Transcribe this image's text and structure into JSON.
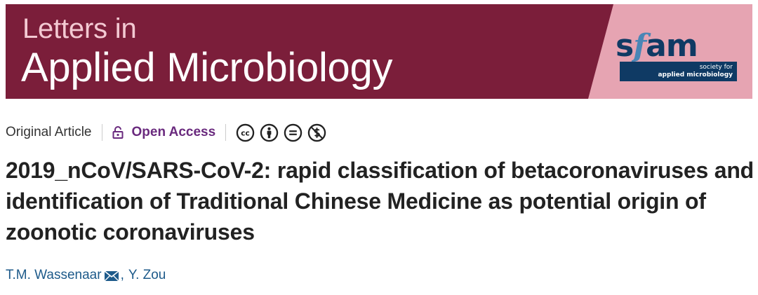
{
  "banner": {
    "journal_line1": "Letters in",
    "journal_line2": "Applied Microbiology",
    "colors": {
      "maroon": "#7b1e3a",
      "pink": "#e6a4b2",
      "navy": "#0f3a64"
    },
    "society_logo": {
      "wordmark_s": "s",
      "wordmark_f": "f",
      "wordmark_am": "am",
      "tagline_line1": "society for",
      "tagline_line2": "applied microbiology"
    }
  },
  "article_meta": {
    "type": "Original Article",
    "access_label": "Open Access",
    "access_icon": "lock-open-icon",
    "license_icons": [
      "creative-commons-icon",
      "attribution-icon",
      "no-derivatives-icon",
      "non-commercial-icon"
    ],
    "license_glyphs": {
      "cc": "cc"
    },
    "access_color": "#6a2a7e"
  },
  "article": {
    "title": "2019_nCoV/SARS-CoV-2: rapid classification of betacoronaviruses and identification of Traditional Chinese Medicine as potential origin of zoonotic coronaviruses"
  },
  "authors": {
    "author1": "T.M. Wassenaar",
    "separator": ",",
    "author2": "Y. Zou",
    "author1_icon": "email-icon",
    "link_color": "#1d5a8a"
  }
}
